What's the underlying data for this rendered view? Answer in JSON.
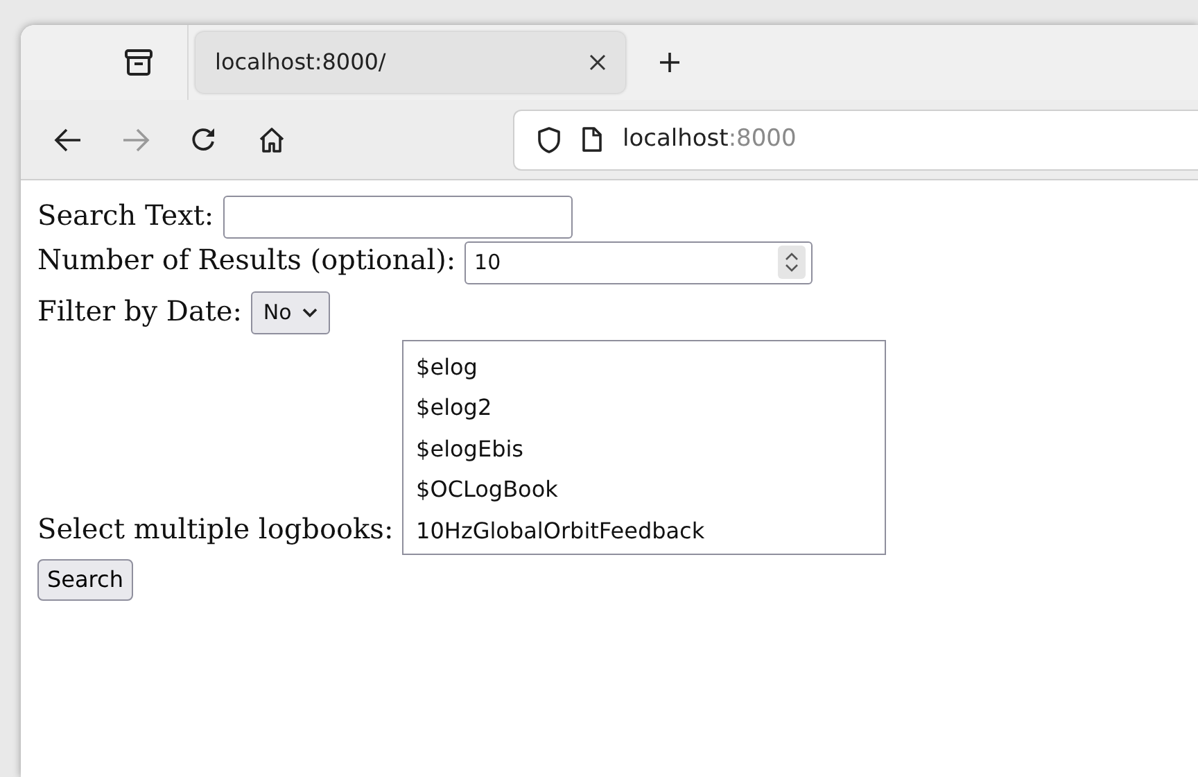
{
  "browser": {
    "tab": {
      "title": "localhost:8000/",
      "selected": true
    },
    "forward": {
      "disabled": true
    },
    "address": {
      "host": "localhost",
      "port": ":8000"
    }
  },
  "form": {
    "search_text": {
      "label": "Search Text:"
    },
    "results": {
      "label": "Number of Results (optional):",
      "value": "10"
    },
    "date_filter": {
      "label": "Filter by Date:",
      "value": "No"
    },
    "logbooks": {
      "label": "Select multiple logbooks:",
      "options": [
        {
          "text": "$elog",
          "selected": false
        },
        {
          "text": "$elog2",
          "selected": false
        },
        {
          "text": "$elogEbis",
          "selected": false
        },
        {
          "text": "$OCLogBook",
          "selected": false
        },
        {
          "text": "10HzGlobalOrbitFeedback",
          "selected": false
        }
      ]
    },
    "button": "Search"
  }
}
